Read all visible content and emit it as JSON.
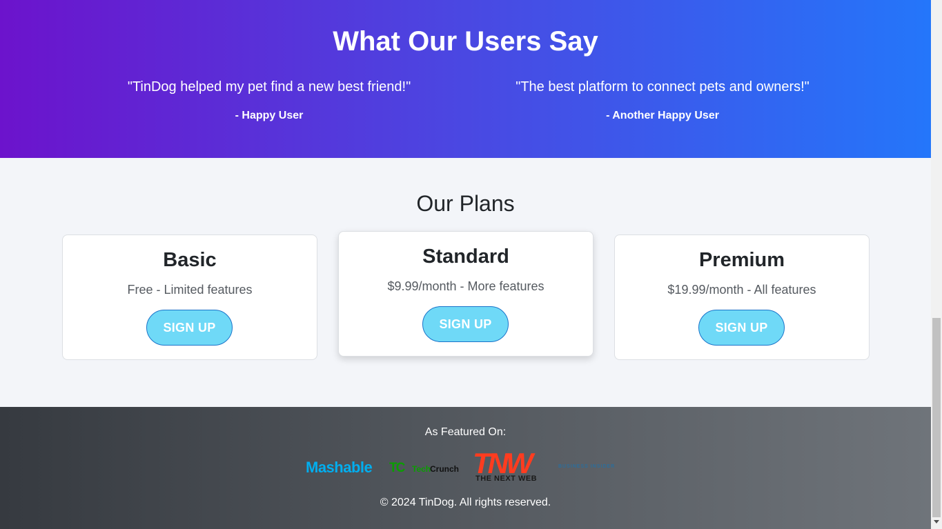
{
  "testimonials": {
    "heading": "What Our Users Say",
    "items": [
      {
        "quote": "\"TinDog helped my pet find a new best friend!\"",
        "author": "- Happy User"
      },
      {
        "quote": "\"The best platform to connect pets and owners!\"",
        "author": "- Another Happy User"
      }
    ]
  },
  "plans": {
    "heading": "Our Plans",
    "items": [
      {
        "name": "Basic",
        "description": "Free - Limited features",
        "button": "SIGN UP"
      },
      {
        "name": "Standard",
        "description": "$9.99/month - More features",
        "button": "SIGN UP"
      },
      {
        "name": "Premium",
        "description": "$19.99/month - All features",
        "button": "SIGN UP"
      }
    ]
  },
  "footer": {
    "featured_label": "As Featured On:",
    "logos": {
      "mashable": "Mashable",
      "techcrunch_mark": "TC",
      "techcrunch_tech": "Tech",
      "techcrunch_crunch": "Crunch",
      "tnw_mark": "TNW",
      "tnw_sub": "THE NEXT WEB",
      "business_insider": "BUSINESS INSIDER"
    },
    "copyright": "© 2024 TinDog. All rights reserved."
  },
  "colors": {
    "gradient_start": "#6c13cc",
    "gradient_end": "#2476fa",
    "button_fill": "#6fd9f7",
    "button_border": "#1a73c9",
    "footer_start": "#363a40",
    "footer_end": "#6f747a"
  }
}
